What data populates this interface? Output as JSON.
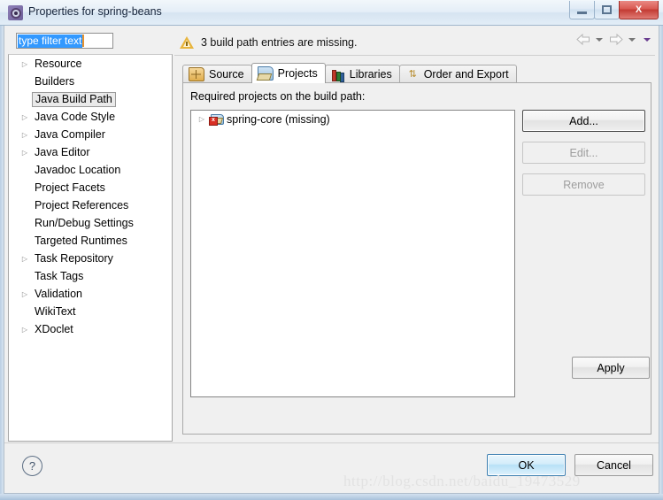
{
  "window": {
    "title": "Properties for spring-beans",
    "app_icon": "properties-gear-icon",
    "minimize_label": "Minimize",
    "maximize_label": "Maximize",
    "close_label": "X"
  },
  "filter": {
    "value": "type filter text",
    "placeholder": "type filter text"
  },
  "sidebar": {
    "items": [
      {
        "label": "Resource",
        "expandable": true,
        "selected": false
      },
      {
        "label": "Builders",
        "expandable": false,
        "selected": false
      },
      {
        "label": "Java Build Path",
        "expandable": false,
        "selected": true
      },
      {
        "label": "Java Code Style",
        "expandable": true,
        "selected": false
      },
      {
        "label": "Java Compiler",
        "expandable": true,
        "selected": false
      },
      {
        "label": "Java Editor",
        "expandable": true,
        "selected": false
      },
      {
        "label": "Javadoc Location",
        "expandable": false,
        "selected": false
      },
      {
        "label": "Project Facets",
        "expandable": false,
        "selected": false
      },
      {
        "label": "Project References",
        "expandable": false,
        "selected": false
      },
      {
        "label": "Run/Debug Settings",
        "expandable": false,
        "selected": false
      },
      {
        "label": "Targeted Runtimes",
        "expandable": false,
        "selected": false
      },
      {
        "label": "Task Repository",
        "expandable": true,
        "selected": false
      },
      {
        "label": "Task Tags",
        "expandable": false,
        "selected": false
      },
      {
        "label": "Validation",
        "expandable": true,
        "selected": false
      },
      {
        "label": "WikiText",
        "expandable": false,
        "selected": false
      },
      {
        "label": "XDoclet",
        "expandable": true,
        "selected": false
      }
    ]
  },
  "message": {
    "text": "3 build path entries are missing.",
    "icon": "warning-icon",
    "severity_color": "#e8b53e"
  },
  "navigation": {
    "back_label": "Back",
    "forward_label": "Forward",
    "menu_label": "View Menu"
  },
  "tabs": [
    {
      "label": "Source",
      "icon": "source-folder-icon",
      "active": false
    },
    {
      "label": "Projects",
      "icon": "open-folder-icon",
      "active": true
    },
    {
      "label": "Libraries",
      "icon": "books-icon",
      "active": false
    },
    {
      "label": "Order and Export",
      "icon": "order-arrows-icon",
      "active": false
    }
  ],
  "panel": {
    "label": "Required projects on the build path:",
    "projects": [
      {
        "name": "spring-core (missing)",
        "icon": "project-error-icon",
        "expandable": true,
        "error_badge": "x"
      }
    ],
    "buttons": [
      {
        "label": "Add...",
        "enabled": true,
        "focused": true
      },
      {
        "label": "Edit...",
        "enabled": false,
        "focused": false
      },
      {
        "label": "Remove",
        "enabled": false,
        "focused": false
      }
    ],
    "apply_label": "Apply"
  },
  "footer": {
    "help_label": "?",
    "ok_label": "OK",
    "cancel_label": "Cancel"
  },
  "watermark": "http://blog.csdn.net/baidu_19473529"
}
